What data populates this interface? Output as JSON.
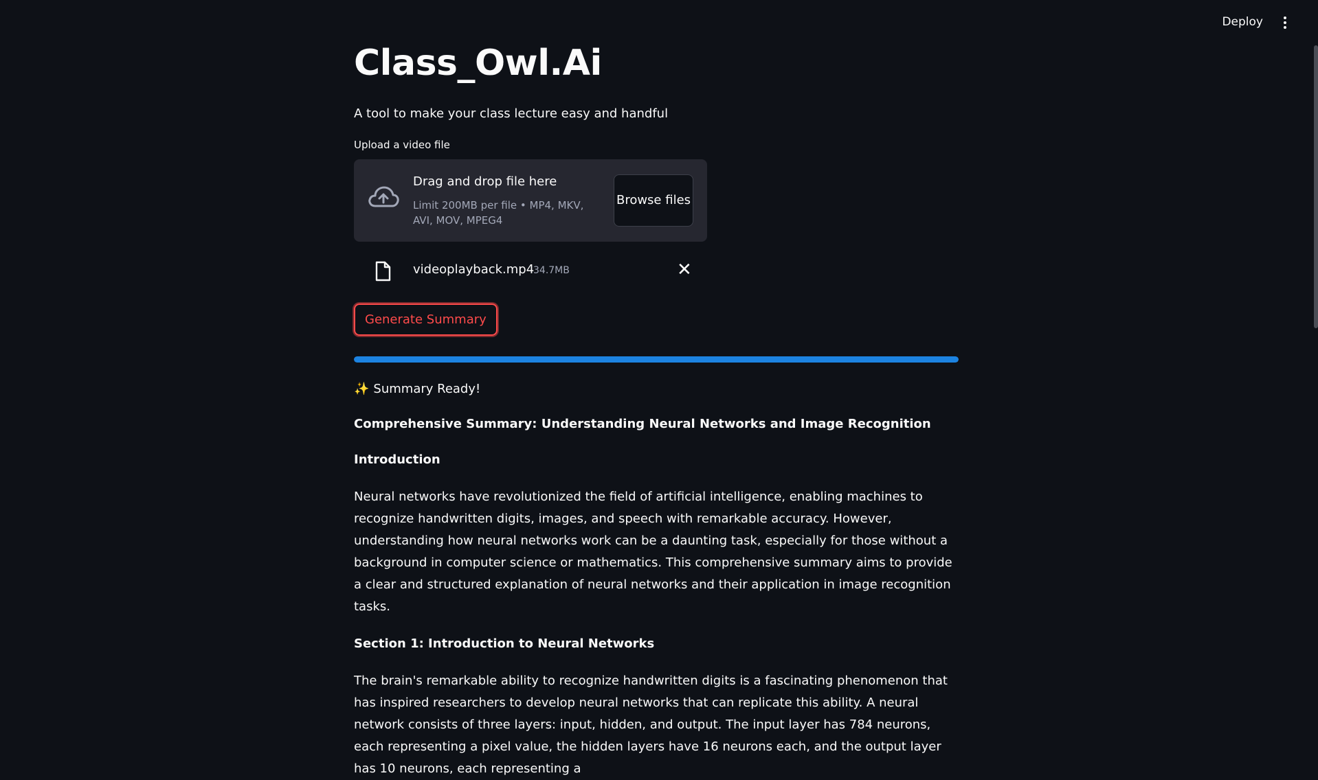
{
  "header": {
    "deploy_label": "Deploy",
    "menu_icon": "kebab-menu-icon"
  },
  "main": {
    "title": "Class_Owl.Ai",
    "subtitle": "A tool to make your class lecture easy and handful",
    "upload": {
      "label": "Upload a video file",
      "drop_title": "Drag and drop file here",
      "limit_text": "Limit 200MB per file • MP4, MKV, AVI, MOV, MPEG4",
      "browse_label": "Browse files",
      "icon": "cloud-upload-icon"
    },
    "file": {
      "name": "videoplayback.mp4",
      "size": "34.7MB",
      "icon": "file-icon",
      "remove_label": "✕"
    },
    "generate_label": "Generate Summary",
    "progress": 1.0,
    "ready_icon": "✨",
    "ready_text": "Summary Ready!",
    "summary": {
      "title": "Comprehensive Summary: Understanding Neural Networks and Image Recognition",
      "intro_heading": "Introduction",
      "intro_text": "Neural networks have revolutionized the field of artificial intelligence, enabling machines to recognize handwritten digits, images, and speech with remarkable accuracy. However, understanding how neural networks work can be a daunting task, especially for those without a background in computer science or mathematics. This comprehensive summary aims to provide a clear and structured explanation of neural networks and their application in image recognition tasks.",
      "section1_heading": "Section 1: Introduction to Neural Networks",
      "section1_text": "The brain's remarkable ability to recognize handwritten digits is a fascinating phenomenon that has inspired researchers to develop neural networks that can replicate this ability. A neural network consists of three layers: input, hidden, and output. The input layer has 784 neurons, each representing a pixel value, the hidden layers have 16 neurons each, and the output layer has 10 neurons, each representing a"
    }
  },
  "colors": {
    "background": "#0e1117",
    "accent": "#ff4b4b",
    "progress": "#1c83e1",
    "dropzone": "#262730"
  }
}
